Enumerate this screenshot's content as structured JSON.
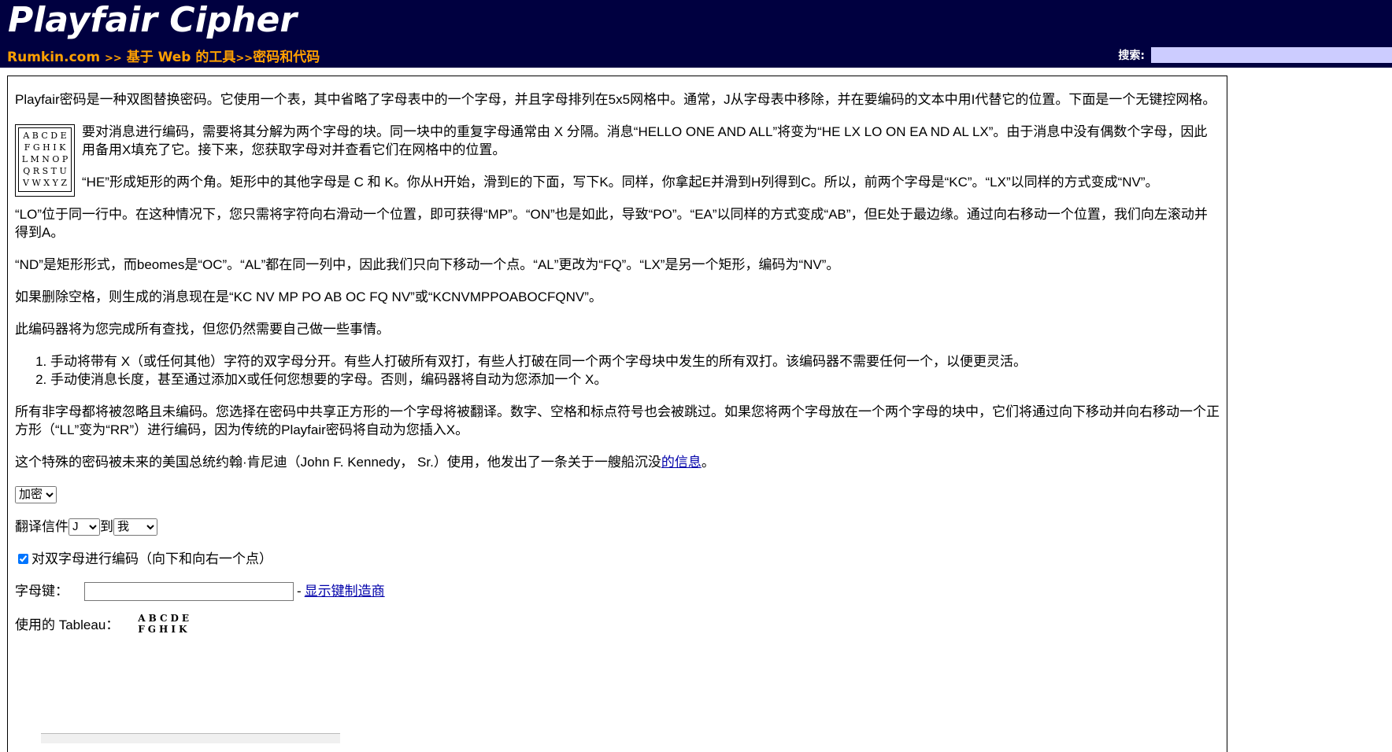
{
  "header": {
    "title": "Playfair Cipher",
    "breadcrumb": {
      "site": "Rumkin.com",
      "sep1": ">>",
      "section": "基于 Web 的工具",
      "sep2": ">>",
      "page": "密码和代码"
    },
    "search_label": "搜索:",
    "search_placeholder": ""
  },
  "content": {
    "intro": "Playfair密码是一种双图替换密码。它使用一个表，其中省略了字母表中的一个字母，并且字母排列在5x5网格中。通常，J从字母表中移除，并在要编码的文本中用I代替它的位置。下面是一个无键控网格。",
    "tableau_rows": [
      "A B C D E",
      "F G H I K",
      "L M N O P",
      "Q R S T U",
      "V W X Y Z"
    ],
    "p_split": "要对消息进行编码，需要将其分解为两个字母的块。同一块中的重复字母通常由 X 分隔。消息“HELLO ONE AND ALL”将变为“HE LX LO ON EA ND AL LX”。由于消息中没有偶数个字母，因此用备用X填充了它。接下来，您获取字母对并查看它们在网格中的位置。",
    "p_he": "“HE”形成矩形的两个角。矩形中的其他字母是 C 和 K。你从H开始，滑到E的下面，写下K。同样，你拿起E并滑到H列得到C。所以，前两个字母是“KC”。“LX”以同样的方式变成“NV”。",
    "p_lo": "“LO”位于同一行中。在这种情况下，您只需将字符向右滑动一个位置，即可获得“MP”。“ON”也是如此，导致“PO”。“EA”以同样的方式变成“AB”，但E处于最边缘。通过向右移动一个位置，我们向左滚动并得到A。",
    "p_nd": "“ND”是矩形形式，而beomes是“OC”。“AL”都在同一列中，因此我们只向下移动一个点。“AL”更改为“FQ”。“LX”是另一个矩形，编码为“NV”。",
    "p_spaces": "如果删除空格，则生成的消息现在是“KC NV MP PO AB OC FQ NV”或“KCNVMPPOABOCFQNV”。",
    "p_encoder": "此编码器将为您完成所有查找，但您仍然需要自己做一些事情。",
    "list": [
      "手动将带有 X（或任何其他）字符的双字母分开。有些人打破所有双打，有些人打破在同一个两个字母块中发生的所有双打。该编码器不需要任何一个，以便更灵活。",
      "手动使消息长度，甚至通过添加X或任何您想要的字母。否则，编码器将自动为您添加一个 X。"
    ],
    "p_nonletters": "所有非字母都将被忽略且未编码。您选择在密码中共享正方形的一个字母将被翻译。数字、空格和标点符号也会被跳过。如果您将两个字母放在一个两个字母的块中，它们将通过向下移动并向右移动一个正方形（“LL”变为“RR”）进行编码，因为传统的Playfair密码将自动为您插入X。",
    "p_kennedy_pre": "这个特殊的密码被未来的美国总统约翰·肯尼迪（John F. Kennedy， Sr.）使用，他发出了一条关于一艘船沉没",
    "p_kennedy_link": "的信息",
    "p_kennedy_post": "。"
  },
  "form": {
    "mode_selected": "加密",
    "translate_label": "翻译信件",
    "from_letter": "J",
    "to_label": "到",
    "to_letter": "我",
    "double_checkbox_label": "对双字母进行编码（向下和向右一个点）",
    "double_checked": true,
    "key_label": "字母键：",
    "key_value": "",
    "key_dash": "-",
    "key_maker_link": "显示键制造商",
    "used_tableau_label": "使用的 Tableau：",
    "used_tableau_rows": [
      "ABCDE",
      "FGHIK"
    ]
  },
  "colors": {
    "header_bg": "#000040",
    "breadcrumb": "#ffa000",
    "search_bg": "#ccccff",
    "link": "#0000aa"
  }
}
